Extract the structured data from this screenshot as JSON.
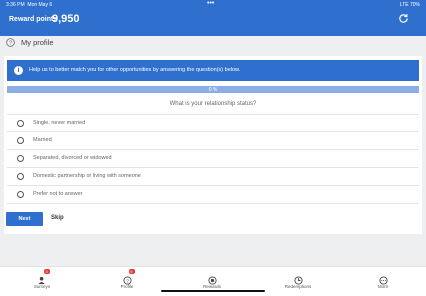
{
  "status_bar": {
    "time": "3:36 PM",
    "date": "Mon May 6",
    "dots": "•••",
    "right": "LTE 70%"
  },
  "header": {
    "reward_label": "Reward points",
    "reward_value": "9,950"
  },
  "profile": {
    "title": "My profile"
  },
  "banner": {
    "text": "Help us to better match you for other opportunities by answering the question(s) below."
  },
  "progress": {
    "label": "0 %",
    "value": 0
  },
  "question": {
    "text": "What is your relationship status?"
  },
  "options": [
    {
      "label": "Single, never married"
    },
    {
      "label": "Married"
    },
    {
      "label": "Separated, divorced or widowed"
    },
    {
      "label": "Domestic partnership or living with someone"
    },
    {
      "label": "Prefer not to answer"
    }
  ],
  "actions": {
    "next_label": "Next",
    "skip_label": "Skip"
  },
  "tabs": [
    {
      "label": "Surveys",
      "icon": "surveys-icon",
      "badge": "3"
    },
    {
      "label": "Profile",
      "icon": "profile-icon",
      "badge": "6"
    },
    {
      "label": "Rewards",
      "icon": "rewards-icon"
    },
    {
      "label": "Redemptions",
      "icon": "redemptions-icon"
    },
    {
      "label": "More",
      "icon": "more-icon"
    }
  ],
  "colors": {
    "primary": "#2f6fce",
    "progress_track": "#8caee5",
    "badge": "#e53935",
    "background": "#eeeff1"
  }
}
